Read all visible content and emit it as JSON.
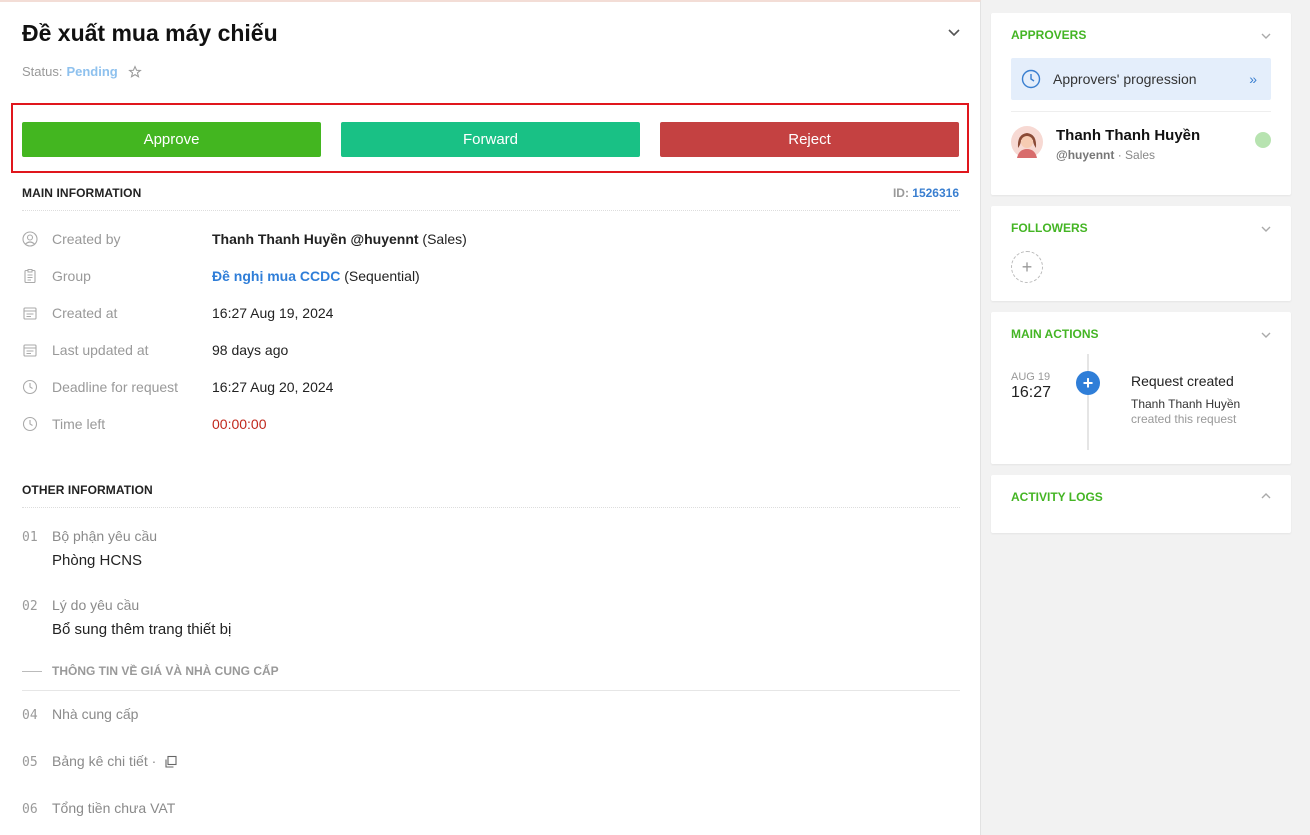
{
  "request": {
    "title": "Đề xuất mua máy chiếu",
    "status_label": "Status:",
    "status_value": "Pending"
  },
  "actions": {
    "approve": "Approve",
    "forward": "Forward",
    "reject": "Reject"
  },
  "main_info": {
    "heading": "MAIN INFORMATION",
    "id_label": "ID:",
    "id_value": "1526316",
    "rows": [
      {
        "label": "Created by",
        "value_bold": "Thanh Thanh Huyền @huyennt",
        "value_rest": " (Sales)",
        "icon": "user-icon"
      },
      {
        "label": "Group",
        "value_link": "Đề nghị mua CCDC",
        "value_rest": " (Sequential)",
        "icon": "clipboard-icon"
      },
      {
        "label": "Created at",
        "value": "16:27 Aug 19, 2024",
        "icon": "calendar-icon"
      },
      {
        "label": "Last updated at",
        "value": "98 days ago",
        "icon": "calendar-icon"
      },
      {
        "label": "Deadline for request",
        "value": "16:27 Aug 20, 2024",
        "icon": "clock-icon"
      },
      {
        "label": "Time left",
        "value": "00:00:00",
        "icon": "clock-icon"
      }
    ]
  },
  "other_info": {
    "heading": "OTHER INFORMATION",
    "fields": [
      {
        "num": "01",
        "label": "Bộ phận yêu cầu",
        "answer": "Phòng HCNS"
      },
      {
        "num": "02",
        "label": "Lý do yêu cầu",
        "answer": "Bổ sung thêm trang thiết bị"
      },
      {
        "num": "04",
        "label": "Nhà cung cấp"
      },
      {
        "num": "05",
        "label": "Bảng kê chi tiết ·"
      },
      {
        "num": "06",
        "label": "Tổng tiền chưa VAT"
      }
    ],
    "subsection": "THÔNG TIN VỀ GIÁ VÀ NHÀ CUNG CẤP"
  },
  "approvers": {
    "heading": "APPROVERS",
    "progression": "Approvers' progression",
    "progression_arrow": "»",
    "name": "Thanh Thanh Huyền",
    "handle": "@huyennt",
    "sub_rest": " · Sales"
  },
  "followers": {
    "heading": "FOLLOWERS",
    "add": "+"
  },
  "main_actions": {
    "heading": "MAIN ACTIONS",
    "date": "AUG 19",
    "time": "16:27",
    "event": "Request created",
    "actor": "Thanh Thanh Huyền",
    "desc": "created this request",
    "dot": "+"
  },
  "activity_logs": {
    "heading": "ACTIVITY LOGS"
  },
  "colors": {
    "approve": "#43b620",
    "forward": "#19c185",
    "reject": "#c44141",
    "accent_green": "#44b524",
    "link_blue": "#2f7ed8"
  }
}
